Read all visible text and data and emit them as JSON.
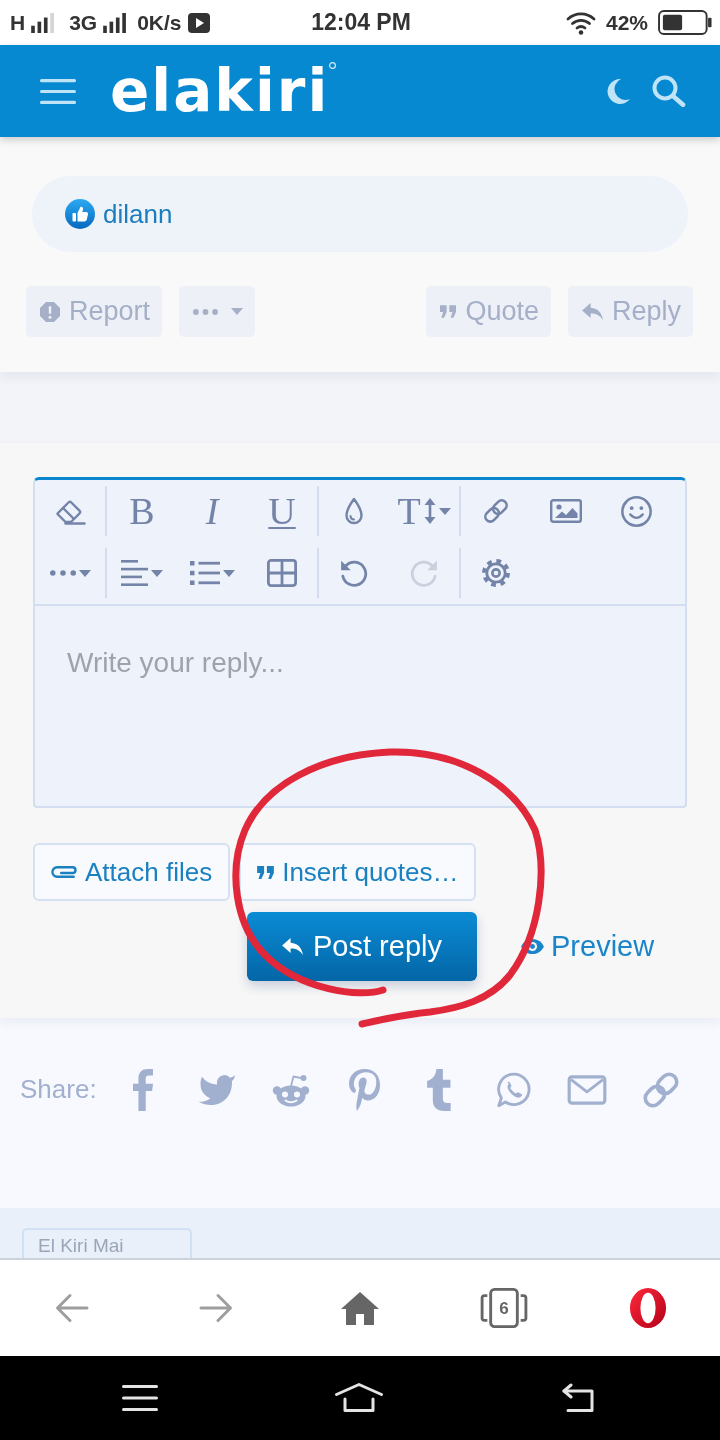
{
  "status_bar": {
    "network_1": "H",
    "network_2": "3G",
    "speed": "0K/s",
    "time": "12:04 PM",
    "battery": "42%"
  },
  "header": {
    "logo": "elakiri"
  },
  "post": {
    "reactions": [
      {
        "user": "dilann"
      }
    ],
    "actions_left": [
      {
        "kind": "report",
        "label": "Report"
      },
      {
        "kind": "more"
      }
    ],
    "actions_right": [
      {
        "kind": "quote",
        "label": "Quote"
      },
      {
        "kind": "reply",
        "label": "Reply"
      }
    ]
  },
  "editor": {
    "toolbar": [
      {
        "groups": [
          [
            {
              "kind": "clear-formatting",
              "disabled": false
            }
          ],
          [
            {
              "kind": "bold",
              "glyph": "B",
              "disabled": false
            },
            {
              "kind": "italic",
              "glyph": "I",
              "disabled": false
            },
            {
              "kind": "underline",
              "glyph": "U",
              "disabled": false
            }
          ],
          [
            {
              "kind": "color",
              "disabled": false
            },
            {
              "kind": "font-size",
              "glyph": "T",
              "disabled": false
            }
          ],
          [
            {
              "kind": "link",
              "disabled": false
            },
            {
              "kind": "image",
              "disabled": false
            },
            {
              "kind": "smilie",
              "disabled": false
            }
          ]
        ]
      },
      {
        "groups": [
          [
            {
              "kind": "more",
              "disabled": false
            }
          ],
          [
            {
              "kind": "align",
              "disabled": false
            },
            {
              "kind": "list",
              "disabled": false
            },
            {
              "kind": "table",
              "disabled": false
            }
          ],
          [
            {
              "kind": "undo",
              "disabled": false
            },
            {
              "kind": "redo",
              "disabled": true
            }
          ],
          [
            {
              "kind": "settings",
              "disabled": false
            }
          ]
        ]
      }
    ],
    "placeholder": "Write your reply...",
    "buttons": [
      {
        "kind": "attach",
        "label": "Attach files"
      },
      {
        "kind": "quote",
        "label": "Insert quotes…"
      }
    ],
    "submit": {
      "label": "Post reply"
    },
    "preview": {
      "label": "Preview"
    }
  },
  "share": {
    "label": "Share:",
    "services": [
      {
        "kind": "facebook"
      },
      {
        "kind": "twitter"
      },
      {
        "kind": "reddit"
      },
      {
        "kind": "pinterest"
      },
      {
        "kind": "tumblr"
      },
      {
        "kind": "whatsapp"
      },
      {
        "kind": "email"
      },
      {
        "kind": "link"
      }
    ]
  },
  "breadcrumb": {
    "label": "El Kiri Mai"
  },
  "browser_bar": {
    "tab_count": "6"
  }
}
